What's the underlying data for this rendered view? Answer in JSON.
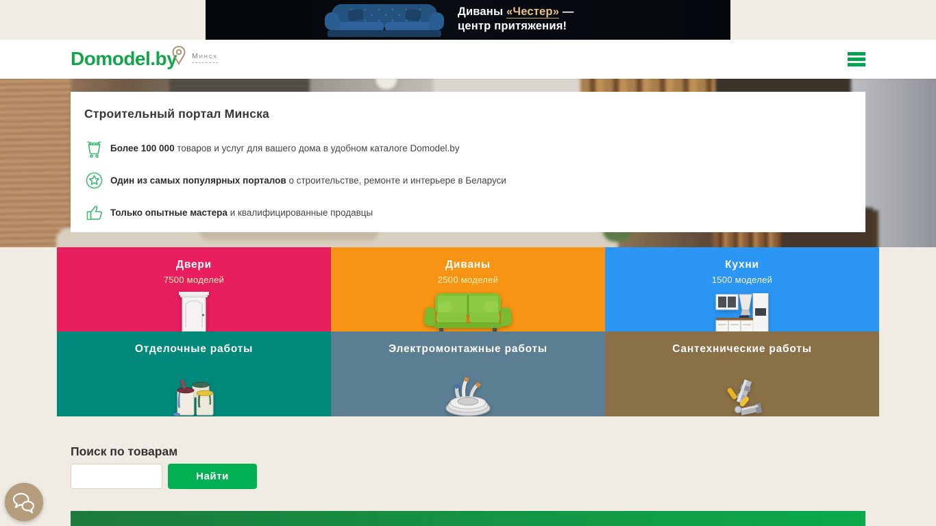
{
  "banner": {
    "line1_prefix": "Диваны ",
    "line1_link": "«Честер»",
    "line1_suffix": " —",
    "line2": "центр притяжения!",
    "bg_color": "#05080d",
    "link_color": "#e6c384"
  },
  "header": {
    "logo": "Domodel.by",
    "logo_color": "#14a54b",
    "city": "Минск",
    "accent_green": "#00a44e"
  },
  "hero": {
    "title": "Строительный портал Минска",
    "items": [
      {
        "icon": "cart-icon",
        "bold": "Более 100 000",
        "text": " товаров и услуг для вашего дома в удобном каталоге Domodel.by"
      },
      {
        "icon": "award-icon",
        "bold": "Один из самых популярных порталов",
        "text": " о строительстве, ремонте и интерьере в Беларуси"
      },
      {
        "icon": "thumbs-up-icon",
        "bold": "Только опытные мастера",
        "text": " и квалифицированные продавцы"
      }
    ]
  },
  "tiles": {
    "items": [
      {
        "title": "Двери",
        "subtitle": "7500 моделей",
        "bg": "#e81e5e",
        "image": "door-image"
      },
      {
        "title": "Диваны",
        "subtitle": "2500 моделей",
        "bg": "#f79413",
        "image": "sofa-image"
      },
      {
        "title": "Кухни",
        "subtitle": "1500 моделей",
        "bg": "#2b96f3",
        "image": "kitchen-image"
      },
      {
        "title": "Отделочные работы",
        "subtitle": "",
        "bg": "#00897b",
        "image": "paint-cans-image"
      },
      {
        "title": "Электромонтажные работы",
        "subtitle": "",
        "bg": "#5c7e93",
        "image": "cable-coil-image"
      },
      {
        "title": "Сантехнические работы",
        "subtitle": "",
        "bg": "#8a7046",
        "image": "pipe-fittings-image"
      }
    ]
  },
  "search": {
    "title": "Поиск по товарам",
    "input_value": "",
    "button_label": "Найти",
    "button_color": "#00b052"
  },
  "footer_bar": {
    "gradient_from": "#1d7a3c",
    "gradient_to": "#0caa4c"
  },
  "chat": {
    "bg_color": "#b49c7c"
  }
}
